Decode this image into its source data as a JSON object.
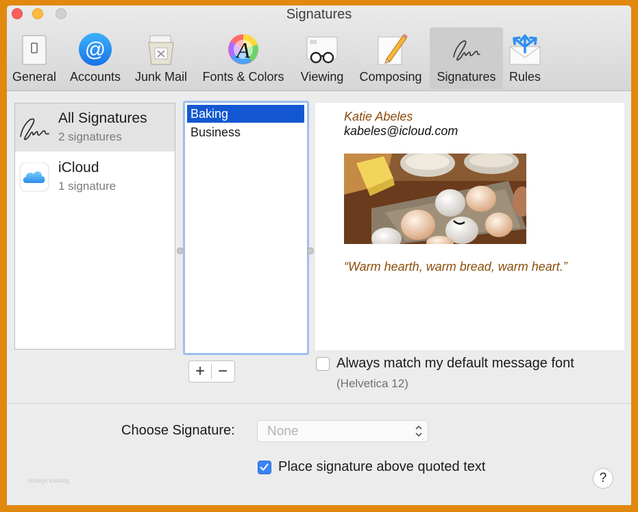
{
  "window": {
    "title": "Signatures"
  },
  "toolbar": [
    {
      "label": "General",
      "icon": "general-switch-icon"
    },
    {
      "label": "Accounts",
      "icon": "at-sign-icon"
    },
    {
      "label": "Junk Mail",
      "icon": "trash-bin-icon"
    },
    {
      "label": "Fonts & Colors",
      "icon": "font-color-wheel-icon"
    },
    {
      "label": "Viewing",
      "icon": "glasses-envelope-icon"
    },
    {
      "label": "Composing",
      "icon": "pencil-paper-icon"
    },
    {
      "label": "Signatures",
      "icon": "signature-icon",
      "active": true
    },
    {
      "label": "Rules",
      "icon": "rules-envelope-icon"
    }
  ],
  "accounts": [
    {
      "name": "All Signatures",
      "count": "2 signatures",
      "icon": "signature-icon",
      "selected": true
    },
    {
      "name": "iCloud",
      "count": "1 signature",
      "icon": "icloud-icon",
      "selected": false
    }
  ],
  "signatures": [
    {
      "name": "Baking",
      "selected": true
    },
    {
      "name": "Business",
      "selected": false
    }
  ],
  "preview": {
    "name": "Katie Abeles",
    "email": "kabeles@icloud.com",
    "quote": "“Warm hearth, warm bread, warm heart.”",
    "image": "eggs-butter-flour-photo"
  },
  "buttons": {
    "add": "+",
    "remove": "−",
    "help": "?"
  },
  "font_match": {
    "label": "Always match my default message font",
    "font_note": "(Helvetica 12)",
    "checked": false
  },
  "choose": {
    "label": "Choose Signature:",
    "value": "None"
  },
  "place_above": {
    "label": "Place signature above quoted text",
    "checked": true
  },
  "watermark": "vorlage katalog",
  "colors": {
    "background": "#e1880f",
    "selection": "#1358d2",
    "accent": "#3a82f7",
    "signature_text": "#8a4d0c"
  }
}
